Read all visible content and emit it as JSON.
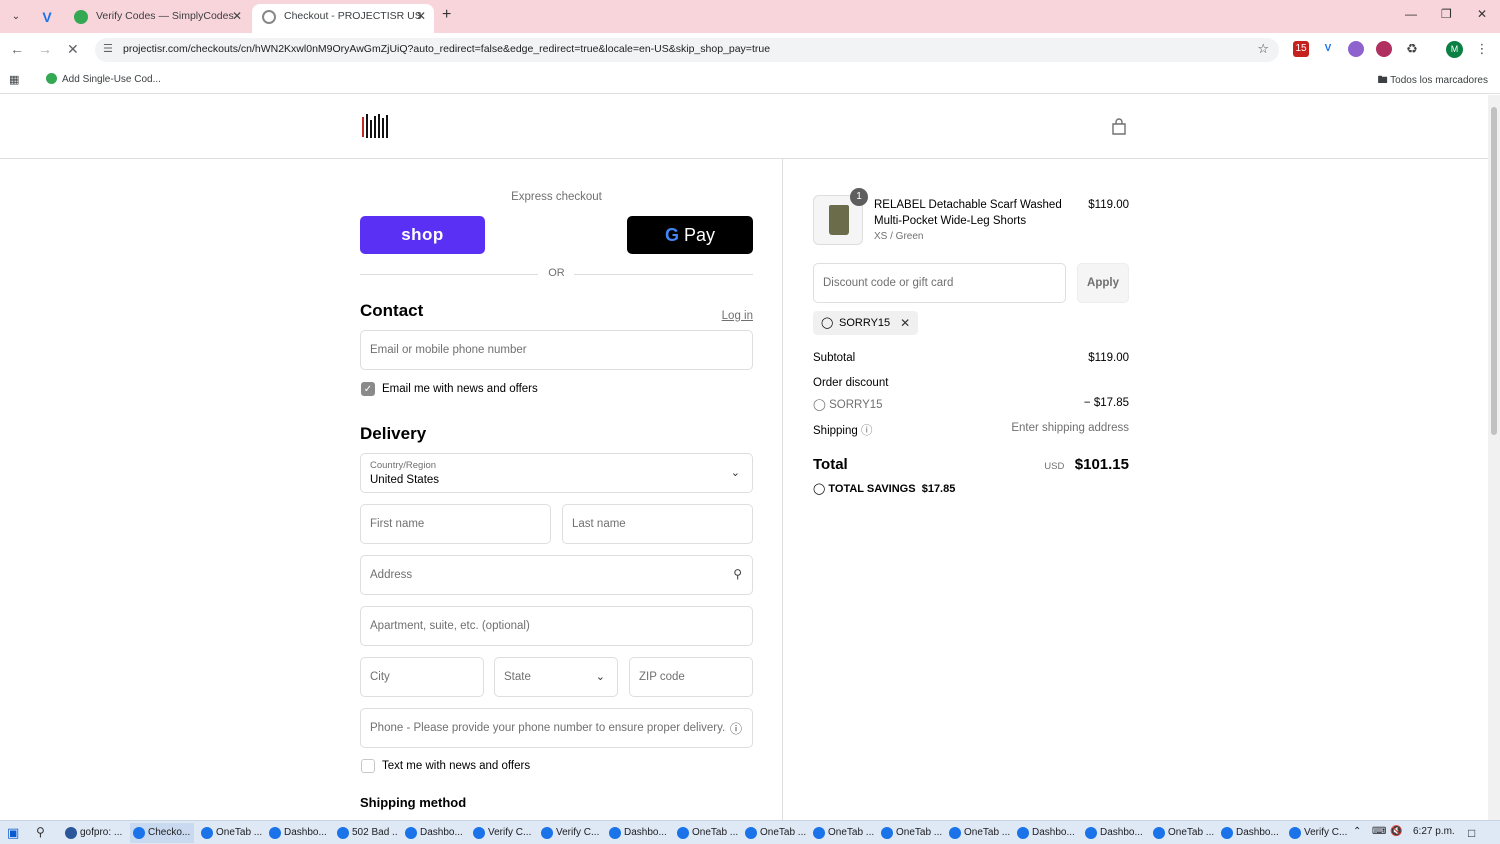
{
  "browser": {
    "tabs": [
      {
        "title": "Verify Codes — SimplyCodes"
      },
      {
        "title": "Checkout - PROJECTISR US"
      }
    ],
    "url": "projectisr.com/checkouts/cn/hWN2Kxwl0nM9OryAwGmZjUiQ?auto_redirect=false&edge_redirect=true&locale=en-US&skip_shop_pay=true",
    "extension_badge": "15",
    "profile_initial": "M",
    "bookmarks": [
      {
        "label": "Add Single-Use Cod..."
      }
    ],
    "all_bookmarks_label": "Todos los marcadores"
  },
  "checkout": {
    "express_label": "Express checkout",
    "shop_pay_label": "shop",
    "gpay_label": "Pay",
    "or_label": "OR",
    "contact": {
      "heading": "Contact",
      "login_link": "Log in",
      "email_placeholder": "Email or mobile phone number",
      "news_label": "Email me with news and offers"
    },
    "delivery": {
      "heading": "Delivery",
      "country_label": "Country/Region",
      "country_value": "United States",
      "first_name_placeholder": "First name",
      "last_name_placeholder": "Last name",
      "address_placeholder": "Address",
      "apartment_placeholder": "Apartment, suite, etc. (optional)",
      "city_placeholder": "City",
      "state_placeholder": "State",
      "zip_placeholder": "ZIP code",
      "phone_placeholder": "Phone - Please provide your phone number to ensure proper delivery.",
      "text_label": "Text me with news and offers"
    },
    "shipping_method_heading": "Shipping method"
  },
  "summary": {
    "product": {
      "quantity": "1",
      "name": "RELABEL Detachable Scarf Washed Multi-Pocket Wide-Leg Shorts",
      "variant": "XS / Green",
      "price": "$119.00"
    },
    "discount_placeholder": "Discount code or gift card",
    "apply_label": "Apply",
    "applied_code": "SORRY15",
    "subtotal_label": "Subtotal",
    "subtotal_value": "$119.00",
    "order_discount_label": "Order discount",
    "discount_code": "SORRY15",
    "discount_value": "− $17.85",
    "shipping_label": "Shipping",
    "shipping_value": "Enter shipping address",
    "total_label": "Total",
    "total_currency": "USD",
    "total_value": "$101.15",
    "savings_label": "TOTAL SAVINGS",
    "savings_value": "$17.85"
  },
  "taskbar": {
    "items": [
      {
        "label": "gofpro: ..."
      },
      {
        "label": "Checko..."
      },
      {
        "label": "OneTab ..."
      },
      {
        "label": "Dashbo..."
      },
      {
        "label": "502 Bad ..."
      },
      {
        "label": "Dashbo..."
      },
      {
        "label": "Verify C..."
      },
      {
        "label": "Verify C..."
      },
      {
        "label": "Dashbo..."
      },
      {
        "label": "OneTab ..."
      },
      {
        "label": "OneTab ..."
      },
      {
        "label": "OneTab ..."
      },
      {
        "label": "OneTab ..."
      },
      {
        "label": "OneTab ..."
      },
      {
        "label": "Dashbo..."
      },
      {
        "label": "Dashbo..."
      },
      {
        "label": "OneTab ..."
      },
      {
        "label": "Dashbo..."
      },
      {
        "label": "Verify C..."
      }
    ],
    "time": "6:27 p.m."
  }
}
